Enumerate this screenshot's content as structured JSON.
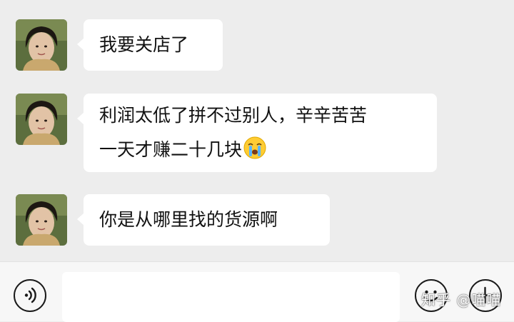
{
  "messages": [
    {
      "sender": "contact",
      "avatar_icon": "portrait-photo",
      "lines": [
        "我要关店了"
      ]
    },
    {
      "sender": "contact",
      "avatar_icon": "portrait-photo",
      "lines": [
        "利润太低了拼不过别人，辛辛苦苦",
        "一天才赚二十几块"
      ],
      "emoji": "loudly-crying-face-emoji"
    },
    {
      "sender": "contact",
      "avatar_icon": "portrait-photo",
      "lines": [
        "你是从哪里找的货源啊"
      ]
    }
  ],
  "input_bar": {
    "voice_icon": "voice-icon",
    "text_value": "",
    "emoji_icon": "smiley-icon",
    "more_icon": "plus-icon"
  },
  "watermark": "知乎 @喵喵",
  "colors": {
    "background": "#ededed",
    "bubble": "#ffffff",
    "input_bar": "#f7f7f7"
  }
}
